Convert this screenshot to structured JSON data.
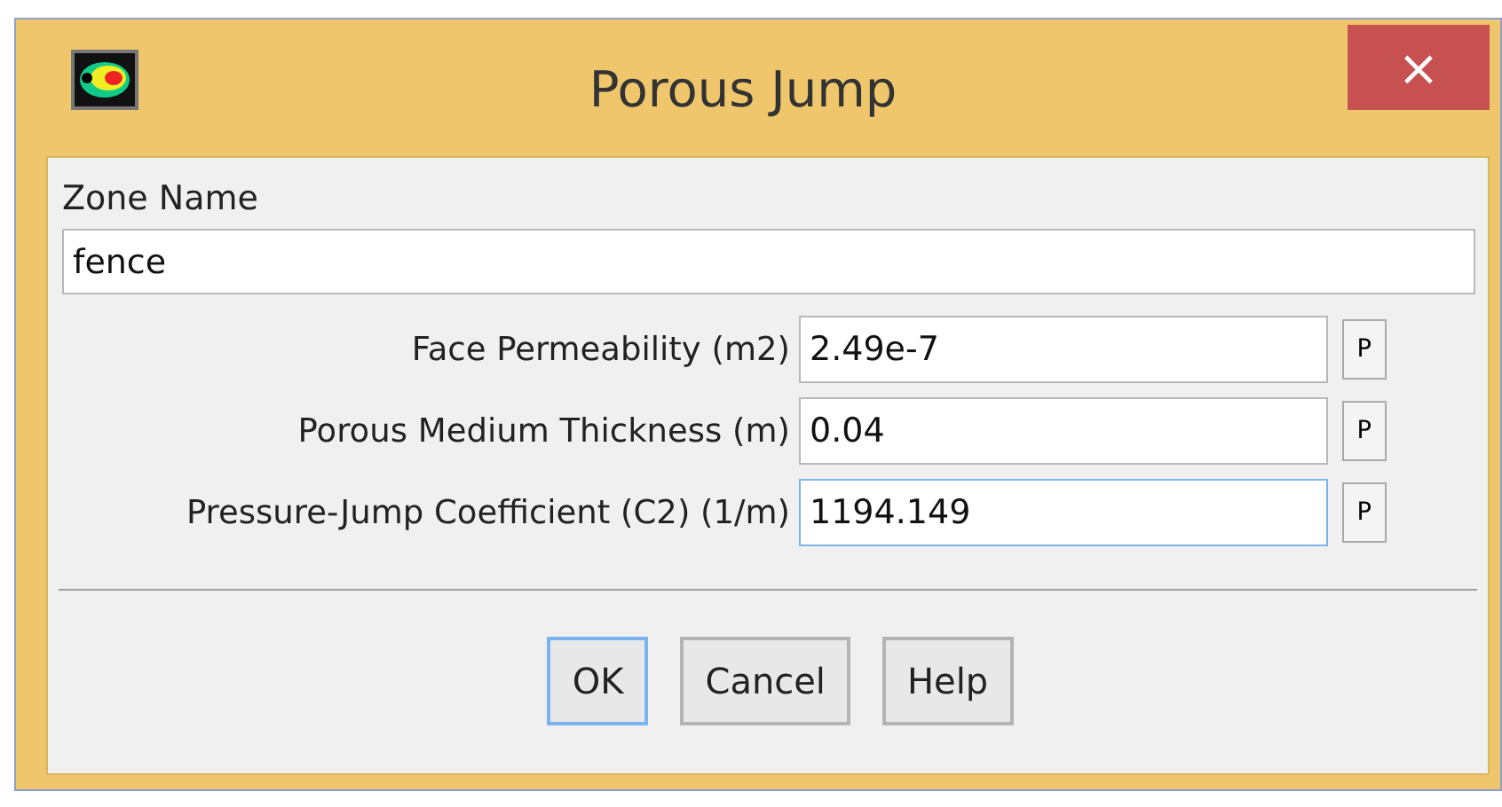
{
  "window": {
    "title": "Porous Jump",
    "close": "×"
  },
  "zone_name": {
    "label": "Zone Name",
    "value": "fence"
  },
  "parameters": [
    {
      "label": "Face Permeability (m2)",
      "value": "2.49e-7",
      "focused": false,
      "button": "P"
    },
    {
      "label": "Porous Medium Thickness (m)",
      "value": "0.04",
      "focused": false,
      "button": "P"
    },
    {
      "label": "Pressure-Jump Coefficient (C2) (1/m)",
      "value": "1194.149",
      "focused": true,
      "button": "P"
    }
  ],
  "buttons": [
    {
      "label": "OK",
      "focused": true
    },
    {
      "label": "Cancel",
      "focused": false
    },
    {
      "label": "Help",
      "focused": false
    }
  ]
}
